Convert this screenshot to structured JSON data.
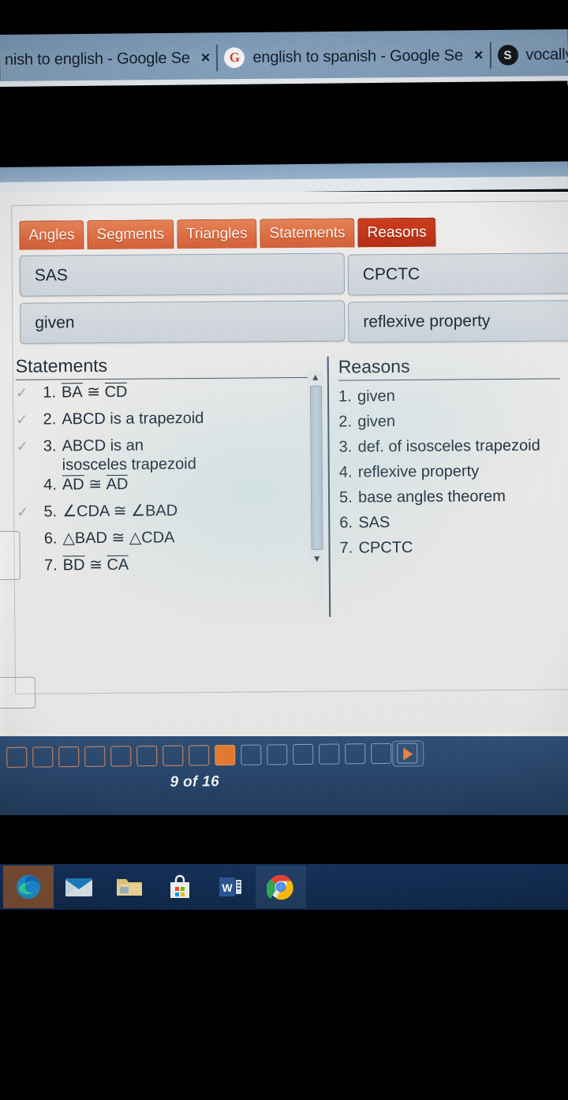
{
  "browser": {
    "tabs": [
      {
        "favicon": "google-icon",
        "favicon_char": "G",
        "title": "nish to english - Google Se",
        "close_label": "×",
        "truncated_left": true,
        "active": false
      },
      {
        "favicon": "google-icon",
        "favicon_char": "G",
        "title": "english to spanish - Google Se",
        "close_label": "×",
        "truncated_left": false,
        "active": false
      },
      {
        "favicon": "socrative-icon",
        "favicon_char": "S",
        "title": "vocally",
        "close_label": "",
        "truncated_left": false,
        "active": true
      }
    ]
  },
  "exercise": {
    "category_tabs": [
      {
        "label": "Angles",
        "selected": false
      },
      {
        "label": "Segments",
        "selected": false
      },
      {
        "label": "Triangles",
        "selected": false
      },
      {
        "label": "Statements",
        "selected": false
      },
      {
        "label": "Reasons",
        "selected": true
      }
    ],
    "answer_bank": [
      {
        "id": "sas",
        "label": "SAS"
      },
      {
        "id": "cpctc",
        "label": "CPCTC"
      },
      {
        "id": "given",
        "label": "given"
      },
      {
        "id": "reflexive",
        "label": "reflexive property"
      }
    ],
    "proof": {
      "statements_header": "Statements",
      "reasons_header": "Reasons",
      "statements": [
        {
          "num": "1.",
          "checked": true,
          "parts": [
            {
              "text": "BA",
              "overline": true
            },
            {
              "text": " ≅ ",
              "overline": false
            },
            {
              "text": "CD",
              "overline": true
            }
          ]
        },
        {
          "num": "2.",
          "checked": true,
          "parts": [
            {
              "text": "ABCD is a trapezoid",
              "overline": false
            }
          ]
        },
        {
          "num": "3.",
          "checked": true,
          "parts": [
            {
              "text": "ABCD is an",
              "overline": false
            },
            {
              "text": "\n",
              "overline": false
            },
            {
              "text": "isosceles trapezoid",
              "overline": false
            }
          ]
        },
        {
          "num": "4.",
          "checked": false,
          "parts": [
            {
              "text": "AD",
              "overline": true
            },
            {
              "text": " ≅ ",
              "overline": false
            },
            {
              "text": "AD",
              "overline": true
            }
          ]
        },
        {
          "num": "5.",
          "checked": true,
          "parts": [
            {
              "text": "∠CDA ≅ ∠BAD",
              "overline": false
            }
          ]
        },
        {
          "num": "6.",
          "checked": false,
          "parts": [
            {
              "text": "△BAD ≅ △CDA",
              "overline": false
            }
          ]
        },
        {
          "num": "7.",
          "checked": false,
          "parts": [
            {
              "text": "BD",
              "overline": true
            },
            {
              "text": " ≅ ",
              "overline": false
            },
            {
              "text": "CA",
              "overline": true
            }
          ]
        }
      ],
      "reasons": [
        {
          "num": "1.",
          "text": "given"
        },
        {
          "num": "2.",
          "text": "given"
        },
        {
          "num": "3.",
          "text": "def. of isosceles trapezoid"
        },
        {
          "num": "4.",
          "text": "reflexive property"
        },
        {
          "num": "5.",
          "text": "base angles theorem"
        },
        {
          "num": "6.",
          "text": "SAS"
        },
        {
          "num": "7.",
          "text": "CPCTC"
        }
      ]
    },
    "check_mark": "✓",
    "scrollbar": {
      "up_arrow": "▲",
      "down_arrow": "▼"
    }
  },
  "pagination": {
    "counter": "9 of 16",
    "total_pages": 16,
    "current_page": 9,
    "next_label": "next-page",
    "colors": {
      "active": "#e07a31",
      "completed_outline": "#d98b63",
      "pending_outline": "#7fa2c6"
    }
  },
  "taskbar": {
    "icons": [
      {
        "name": "edge-icon",
        "label": "Microsoft Edge",
        "state": "highlight"
      },
      {
        "name": "mail-icon",
        "label": "Mail",
        "state": "normal"
      },
      {
        "name": "file-explorer-icon",
        "label": "File Explorer",
        "state": "normal"
      },
      {
        "name": "microsoft-store-icon",
        "label": "Microsoft Store",
        "state": "normal"
      },
      {
        "name": "word-icon",
        "label": "Word",
        "state": "normal"
      },
      {
        "name": "chrome-icon",
        "label": "Google Chrome",
        "state": "tint"
      }
    ]
  },
  "theme": {
    "tab_orange": "#dd6d42",
    "tab_selected_red": "#c2351a",
    "page_bg": "#eceae7",
    "pagebar_blue": "#284468",
    "taskbar_blue": "#10294b",
    "text_dark": "#1d2b38"
  }
}
